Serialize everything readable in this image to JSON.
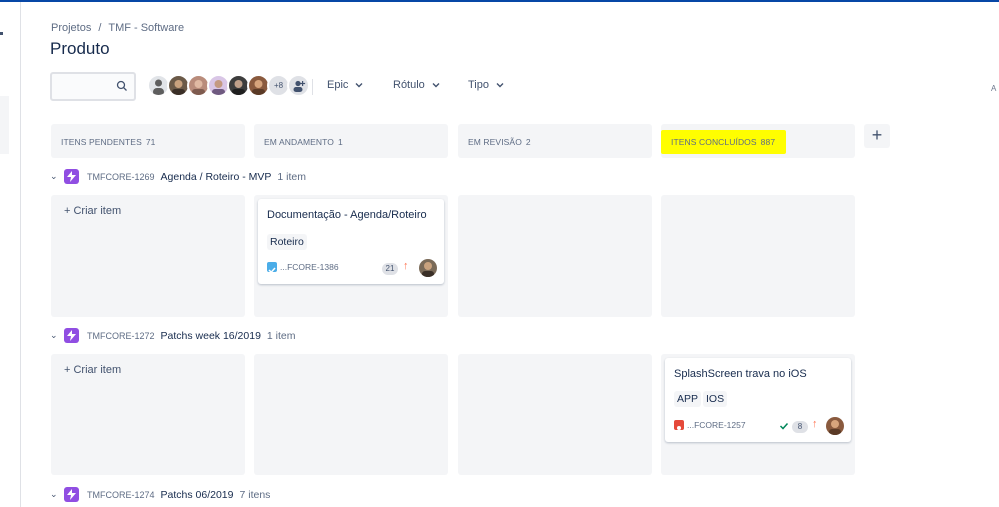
{
  "breadcrumb": {
    "projects": "Projetos",
    "separator": "/",
    "project": "TMF - Software"
  },
  "page": {
    "title": "Produto"
  },
  "search": {
    "value": ""
  },
  "avatars": {
    "more": "+8"
  },
  "filters": [
    {
      "label": "Epic"
    },
    {
      "label": "Rótulo"
    },
    {
      "label": "Tipo"
    }
  ],
  "edge": {
    "text": "A"
  },
  "columns": [
    {
      "name": "ITENS PENDENTES",
      "count": "71"
    },
    {
      "name": "EM ANDAMENTO",
      "count": "1"
    },
    {
      "name": "EM REVISÃO",
      "count": "2"
    },
    {
      "name": "ITENS CONCLUÍDOS",
      "count": "887"
    }
  ],
  "add_column": {
    "icon": "plus-icon",
    "label": "+"
  },
  "swimlanes": [
    {
      "key": "TMFCORE-1269",
      "title": "Agenda / Roteiro - MVP",
      "items": "1 item"
    },
    {
      "key": "TMFCORE-1272",
      "title": "Patchs week 16/2019",
      "items": "1 item"
    },
    {
      "key": "TMFCORE-1274",
      "title": "Patchs 06/2019",
      "items": "7 itens"
    }
  ],
  "create_item": "+ Criar item",
  "cards": [
    {
      "summary": "Documentação - Agenda/Roteiro",
      "labels": [
        "Roteiro"
      ],
      "key": "...FCORE-1386",
      "estimate": "21",
      "type_color": "#4bade8",
      "priority_icon": "arrow-up-icon"
    },
    {
      "summary": "SplashScreen trava no iOS",
      "labels": [
        "APP",
        "IOS"
      ],
      "key": "...FCORE-1257",
      "estimate": "8",
      "type_color": "#e5493a",
      "priority_icon": "arrow-up-icon",
      "done_icon": "check-icon"
    }
  ],
  "colors": {
    "highlight": "#fffe00",
    "epic": "#904ee2",
    "priority": "#ff7452",
    "done": "#00875a"
  }
}
